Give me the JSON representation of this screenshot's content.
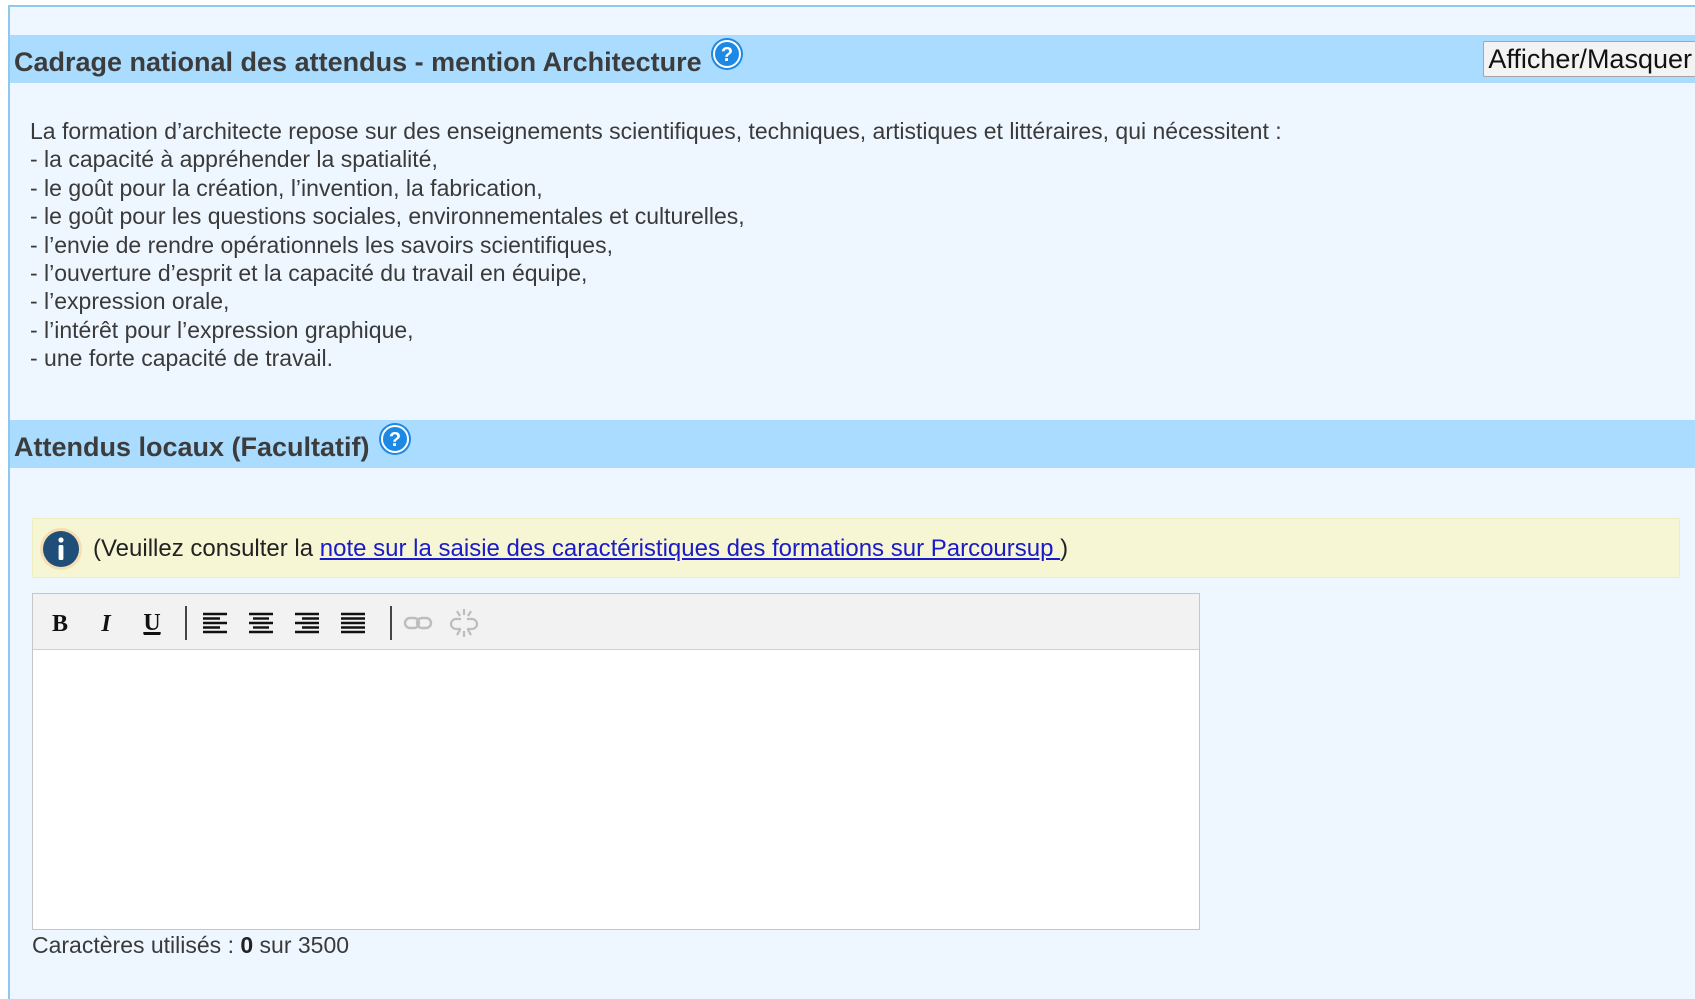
{
  "national": {
    "title": "Cadrage national des attendus - mention Architecture",
    "toggle_label": "Afficher/Masquer",
    "lines": [
      "La formation d’architecte repose sur des enseignements scientifiques, techniques, artistiques et littéraires, qui nécessitent :",
      "- la capacité à appréhender la spatialité,",
      "- le goût pour la création, l’invention, la fabrication,",
      "- le goût pour les questions sociales, environnementales et culturelles,",
      "- l’envie de rendre opérationnels les savoirs scientifiques,",
      "- l’ouverture d’esprit et la capacité du travail en équipe,",
      "- l’expression orale,",
      "- l’intérêt pour l’expression graphique,",
      "- une forte capacité de travail."
    ]
  },
  "local": {
    "title": "Attendus locaux (Facultatif)",
    "info_prefix": "(Veuillez consulter la ",
    "info_link": "note sur la saisie des caractéristiques des formations sur Parcoursup ",
    "info_suffix": " )"
  },
  "editor": {
    "toolbar": {
      "bold": "B",
      "italic": "I",
      "underline": "U"
    },
    "content": ""
  },
  "char_count": {
    "prefix": "Caractères utilisés : ",
    "used": "0",
    "suffix": " sur 3500"
  },
  "colors": {
    "header_bg": "#aadcff",
    "panel_bg": "#eef7ff",
    "info_bg": "#f6f6d4",
    "link": "#1a1ac8",
    "help_icon": "#1e88e5"
  }
}
